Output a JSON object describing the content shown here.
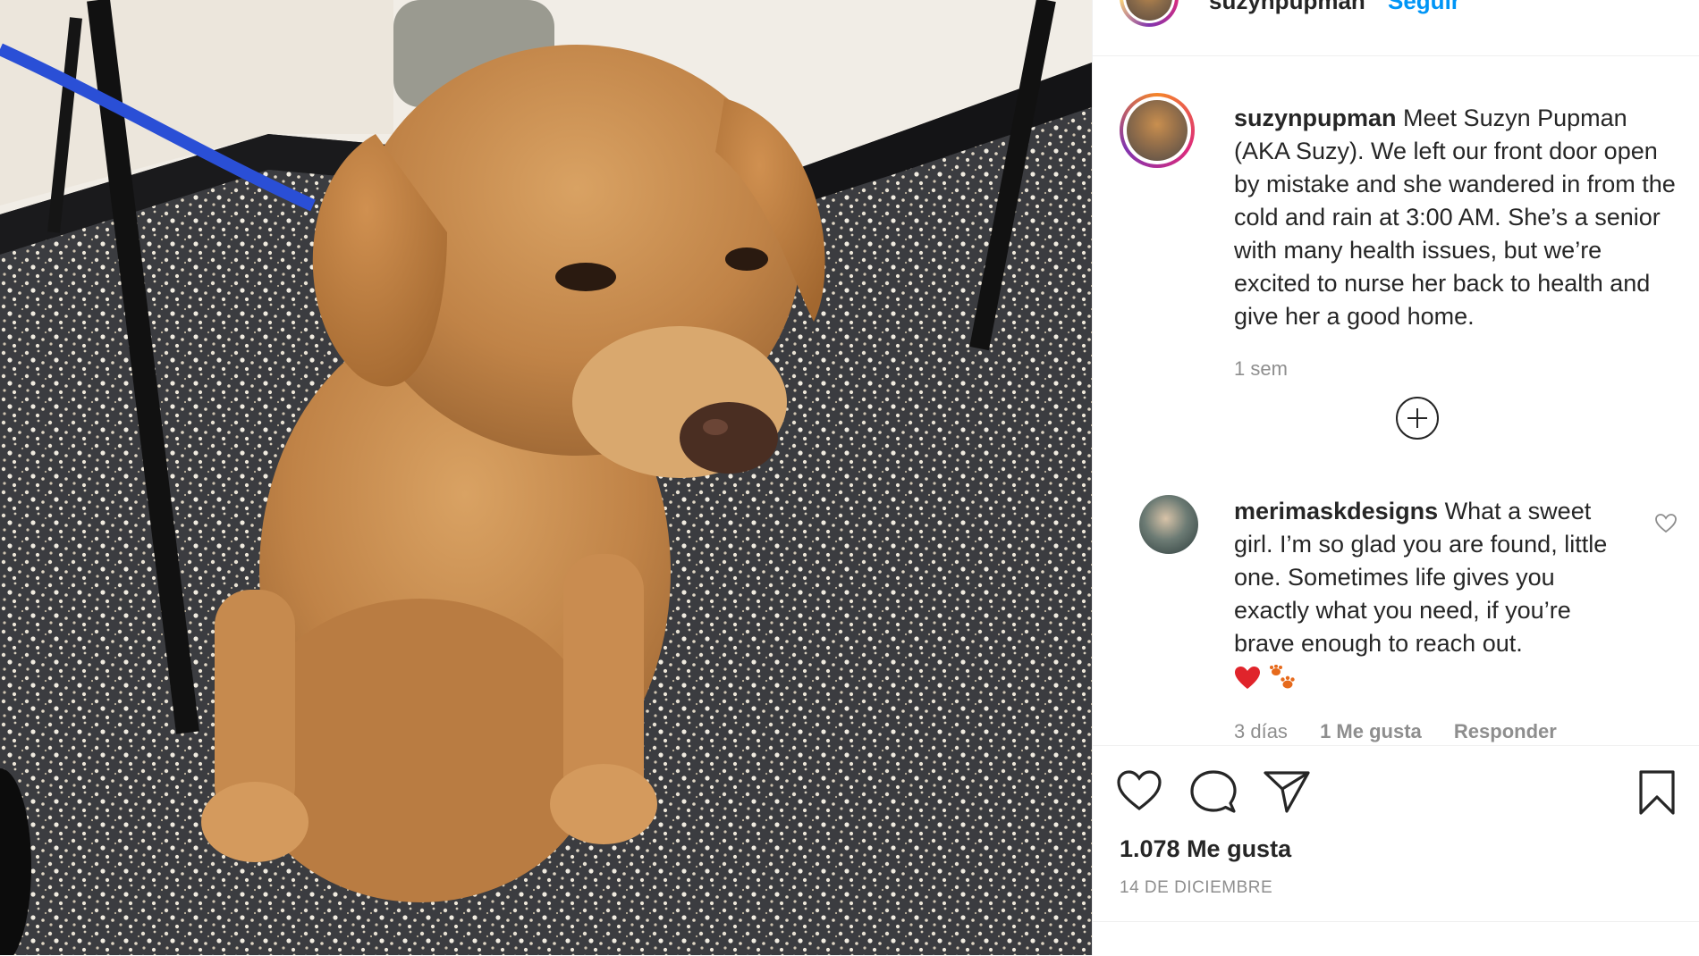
{
  "post": {
    "author": "suzynpupman",
    "follow_label": "Seguir",
    "caption_text": "Meet Suzyn Pupman (AKA Suzy). We left our front door open by mistake and she wandered in from the cold and rain at 3:00 AM. She’s a senior with many health issues, but we’re excited to nurse her back to health and give her a good home.",
    "caption_time": "1 sem"
  },
  "comment": {
    "author": "merimaskdesigns",
    "text": "What a sweet girl. I’m so glad you are found, little one. Sometimes life gives you exactly what you need, if you’re brave enough to reach out.",
    "emoji": [
      "red-heart",
      "paw-prints"
    ],
    "time": "3 días",
    "likes": "1 Me gusta",
    "reply_label": "Responder"
  },
  "footer": {
    "likes_count": "1.078 Me gusta",
    "date": "14 DE DICIEMBRE"
  },
  "icons": {
    "like": "heart-icon",
    "comment": "comment-icon",
    "share": "paper-plane-icon",
    "save": "bookmark-icon",
    "load_more": "plus-circle-icon",
    "comment_like": "small-heart-icon"
  },
  "colors": {
    "text": "#262626",
    "muted": "#8e8e8e",
    "link": "#0095f6",
    "divider": "#efefef",
    "emoji_heart": "#e0242b",
    "emoji_paw": "#e66a1c"
  }
}
